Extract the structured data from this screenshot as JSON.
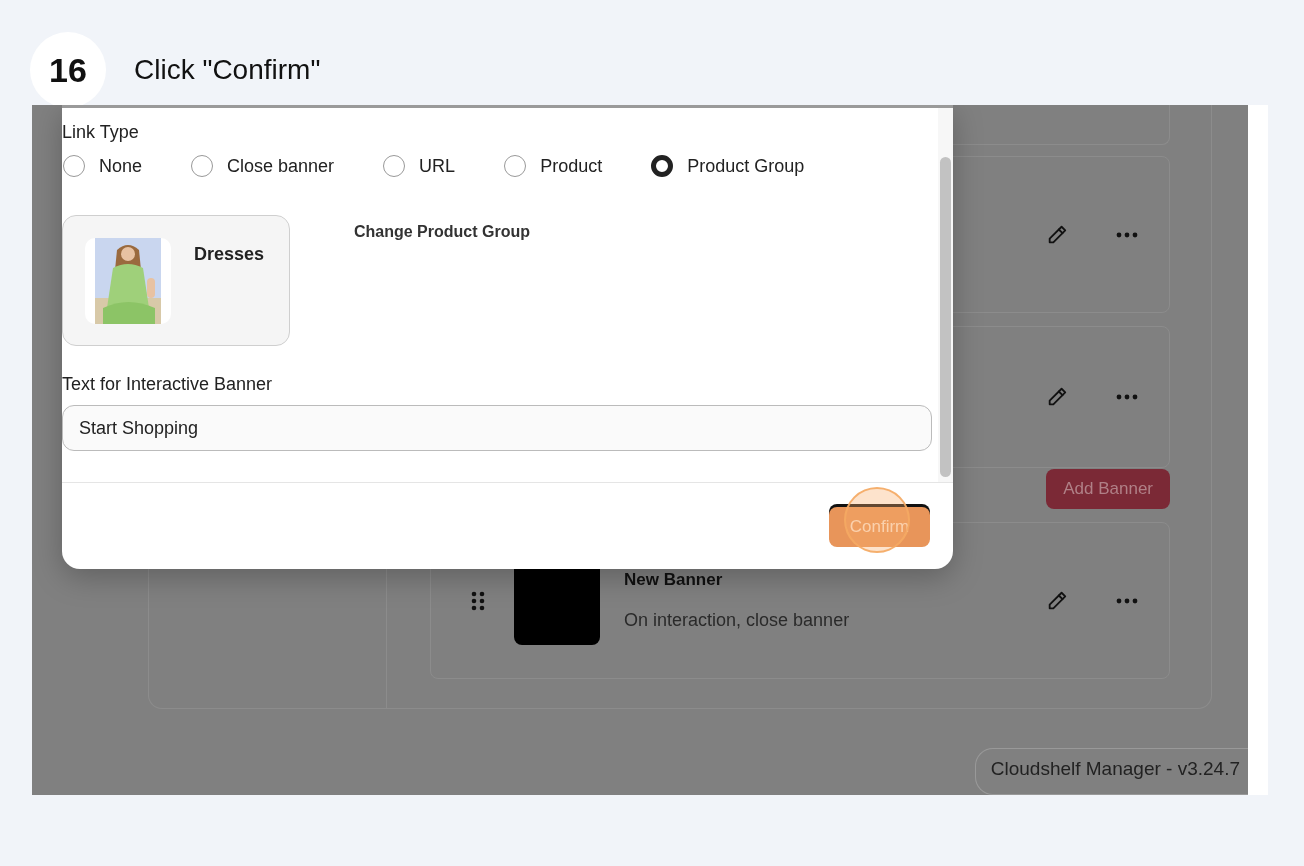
{
  "step": {
    "number": "16",
    "instruction": "Click \"Confirm\""
  },
  "modal": {
    "link_type": {
      "label": "Link Type",
      "options": [
        {
          "label": "None",
          "selected": false
        },
        {
          "label": "Close banner",
          "selected": false
        },
        {
          "label": "URL",
          "selected": false
        },
        {
          "label": "Product",
          "selected": false
        },
        {
          "label": "Product Group",
          "selected": true
        }
      ]
    },
    "product_group": {
      "name": "Dresses",
      "change_label": "Change Product Group"
    },
    "banner_text": {
      "label": "Text for Interactive Banner",
      "value": "Start Shopping"
    },
    "confirm_button": {
      "label": "Confirm",
      "highlighted": true
    }
  },
  "banners": [
    {
      "kind": "clipped"
    },
    {
      "kind": "covered"
    },
    {
      "kind": "covered"
    },
    {
      "kind": "add_button",
      "label": "Add Banner"
    },
    {
      "kind": "full",
      "title": "New Banner",
      "subtitle": "On interaction, close banner"
    }
  ],
  "footer": {
    "version": "Cloudshelf Manager - v3.24.7"
  }
}
